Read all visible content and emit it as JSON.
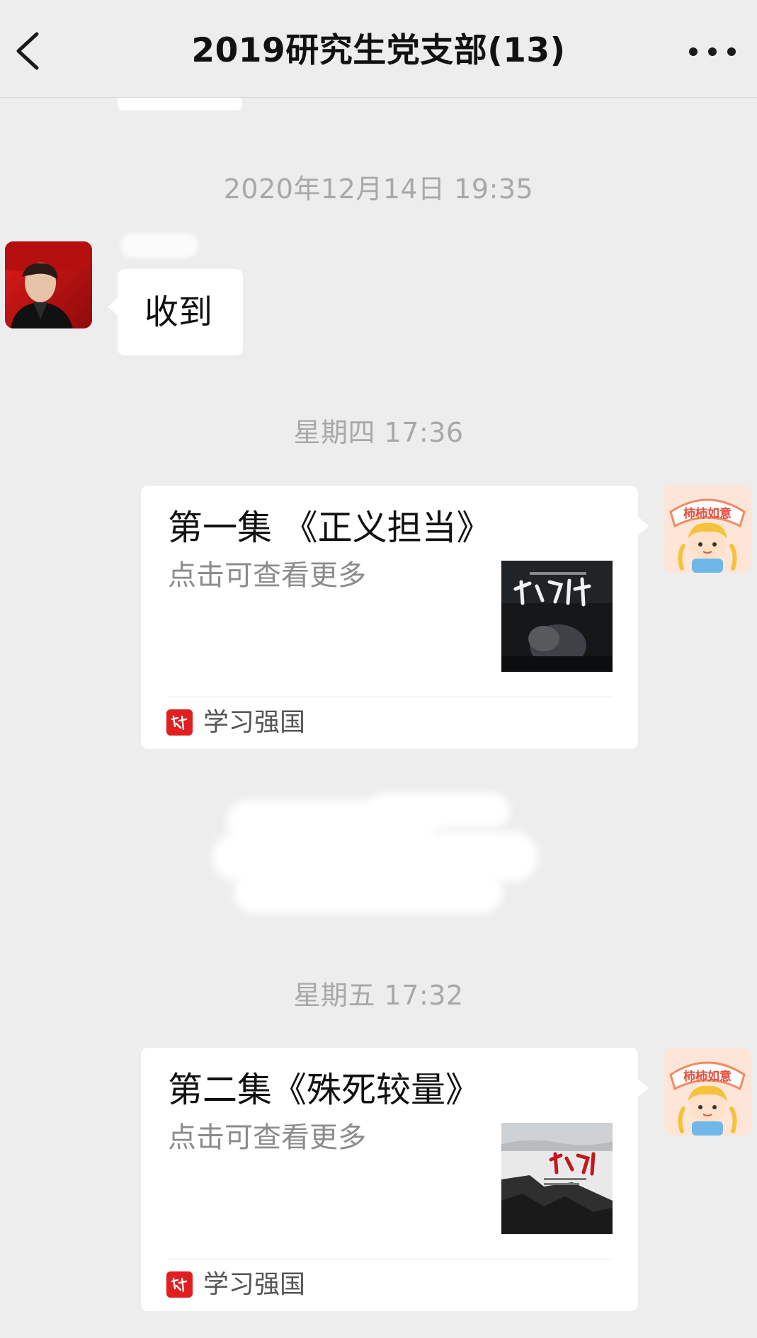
{
  "header": {
    "title": "2019研究生党支部(13)",
    "back_icon": "chevron-left-icon",
    "more_icon": "more-horizontal-icon"
  },
  "timestamps": {
    "first": "2020年12月14日 19:35",
    "second": "星期四 17:36",
    "third": "星期五 17:32"
  },
  "incoming_message": {
    "text": "收到"
  },
  "cards": [
    {
      "title": "第一集 《正义担当》",
      "description": "点击可查看更多",
      "source": "学习强国"
    },
    {
      "title": "第二集《殊死较量》",
      "description": "点击可查看更多",
      "source": "学习强国"
    }
  ],
  "colors": {
    "background": "#ededed",
    "bubble": "#ffffff",
    "timestamp": "#a8a8a8",
    "source_logo": "#e02020"
  }
}
